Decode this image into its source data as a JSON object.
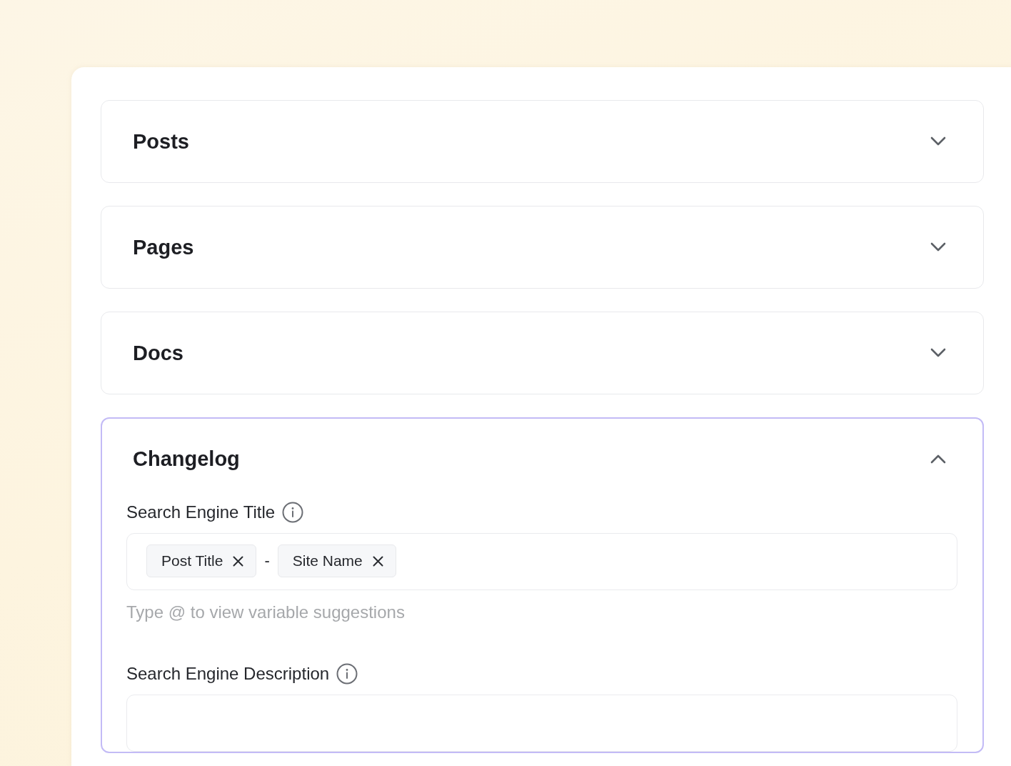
{
  "sections": [
    {
      "title": "Posts",
      "expanded": false
    },
    {
      "title": "Pages",
      "expanded": false
    },
    {
      "title": "Docs",
      "expanded": false
    },
    {
      "title": "Changelog",
      "expanded": true,
      "fields": [
        {
          "kind": "tokens",
          "label": "Search Engine Title",
          "tokens": [
            {
              "kind": "chip",
              "label": "Post Title"
            },
            {
              "kind": "separator",
              "text": "-"
            },
            {
              "kind": "chip",
              "label": "Site Name"
            }
          ],
          "hint": "Type @ to view variable suggestions"
        },
        {
          "kind": "text",
          "label": "Search Engine Description"
        }
      ]
    }
  ]
}
